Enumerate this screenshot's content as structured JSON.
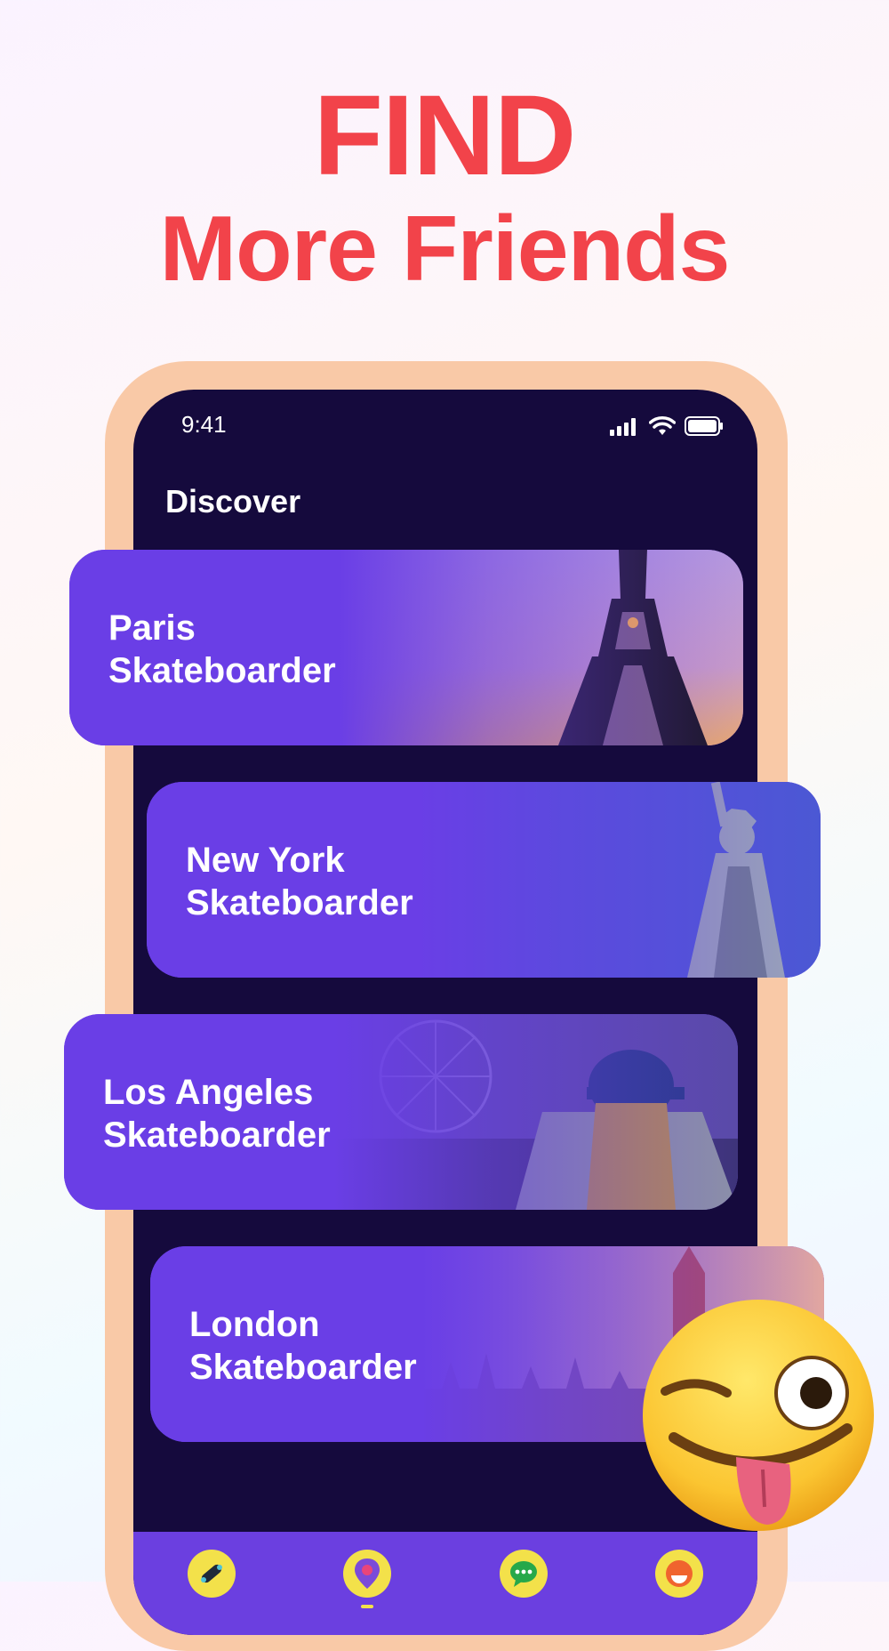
{
  "headline": {
    "line1": "FIND",
    "line2": "More Friends"
  },
  "status_bar": {
    "time": "9:41"
  },
  "screen": {
    "title": "Discover"
  },
  "cards": [
    {
      "line1": "Paris",
      "line2": "Skateboarder"
    },
    {
      "line1": "New York",
      "line2": "Skateboarder"
    },
    {
      "line1": "Los Angeles",
      "line2": "Skateboarder"
    },
    {
      "line1": "London",
      "line2": "Skateboarder"
    }
  ],
  "bottom_nav": [
    {
      "icon": "skateboard-icon"
    },
    {
      "icon": "location-pin-icon",
      "active": true
    },
    {
      "icon": "chat-bubble-icon"
    },
    {
      "icon": "profile-icon"
    }
  ],
  "colors": {
    "headline": "#f2434a",
    "phone_frame": "#f9c9a7",
    "screen_bg": "#150a3d",
    "card_purple": "#6a3ee6",
    "nav_bg": "#6b3fe0",
    "nav_button": "#f3e14a"
  }
}
